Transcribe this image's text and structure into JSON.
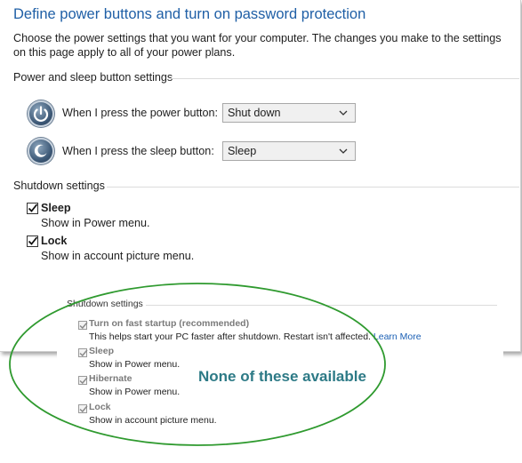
{
  "header": {
    "title": "Define power buttons and turn on password protection",
    "description": "Choose the power settings that you want for your computer. The changes you make to the settings on this page apply to all of your power plans."
  },
  "power_sleep": {
    "section_label": "Power and sleep button settings",
    "power_button_label": "When I press the power button:",
    "power_button_value": "Shut down",
    "sleep_button_label": "When I press the sleep button:",
    "sleep_button_value": "Sleep"
  },
  "shutdown": {
    "section_label": "Shutdown settings",
    "items": [
      {
        "label": "Sleep",
        "description": "Show in Power menu.",
        "checked": true
      },
      {
        "label": "Lock",
        "description": "Show in account picture menu.",
        "checked": true
      }
    ]
  },
  "inset": {
    "section_label": "Shutdown settings",
    "items": [
      {
        "label": "Turn on fast startup (recommended)",
        "description": "This helps start your PC faster after shutdown. Restart isn't affected.",
        "link": "Learn More",
        "checked": true
      },
      {
        "label": "Sleep",
        "description": "Show in Power menu.",
        "checked": true
      },
      {
        "label": "Hibernate",
        "description": "Show in Power menu.",
        "checked": true
      },
      {
        "label": "Lock",
        "description": "Show in account picture menu.",
        "checked": true
      }
    ],
    "annotation": "None of these available"
  },
  "colors": {
    "title_blue": "#1f5fa6",
    "link_blue": "#1a5fb4",
    "annotation_teal": "#2d7a86",
    "ellipse_green": "#2f9a2f"
  },
  "icons": [
    "power-icon",
    "sleep-icon",
    "chevron-down-icon",
    "checkmark-icon"
  ]
}
